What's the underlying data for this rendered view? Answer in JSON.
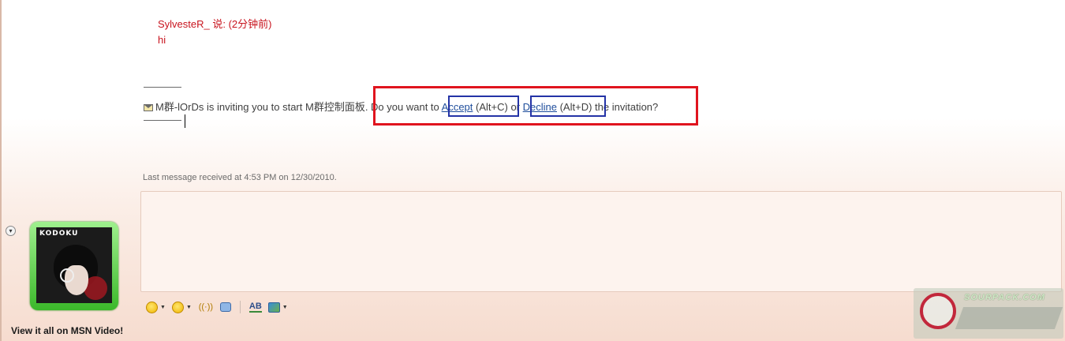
{
  "conversation": {
    "sender_line": "SylvesteR_ 说: (2分钟前)",
    "message": "hi"
  },
  "invitation": {
    "text_before": "M群-lOrDs is inviting you to start M群控制面板. Do you want to ",
    "accept_label": "Accept",
    "accept_shortcut": " (Alt+C) ",
    "or_text": "or ",
    "decline_label": "Decline",
    "decline_shortcut": " (Alt+D) ",
    "text_after": "the invitation?"
  },
  "status": {
    "last_message": "Last message received at 4:53 PM on 12/30/2010."
  },
  "sidebar": {
    "avatar_text": "KODOKU",
    "video_link": "View it all on MSN Video!"
  },
  "toolbar": {
    "icons": [
      "emoticon-icon",
      "wink-icon",
      "nudge-icon",
      "voice-clip-icon",
      "font-icon",
      "background-icon"
    ],
    "nudge_glyph": "((·))",
    "font_glyph": "AB"
  },
  "watermark": {
    "site": "SOURPACK.COM"
  },
  "colors": {
    "sender": "#c8141e",
    "link": "#1f4e9c",
    "highlight_red": "#e0141e",
    "highlight_blue": "#2433a6",
    "avatar_frame": "#3bb82a"
  }
}
